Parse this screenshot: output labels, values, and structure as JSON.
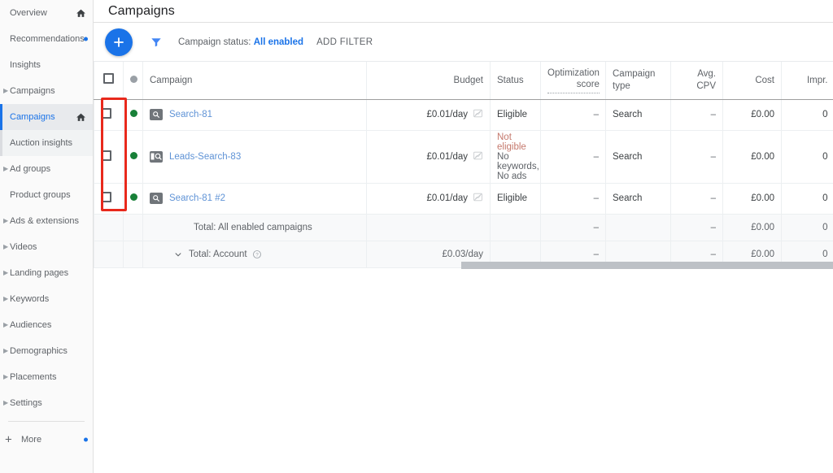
{
  "sidebar": {
    "items": [
      {
        "label": "Overview",
        "icon": "home-icon",
        "arrow": false,
        "dot": false,
        "state": "normal"
      },
      {
        "label": "Recommendations",
        "icon": "",
        "arrow": false,
        "dot": true,
        "state": "normal"
      },
      {
        "label": "Insights",
        "icon": "",
        "arrow": false,
        "dot": false,
        "state": "normal"
      },
      {
        "label": "Campaigns",
        "icon": "",
        "arrow": true,
        "dot": false,
        "state": "group"
      },
      {
        "label": "Campaigns",
        "icon": "home-icon",
        "arrow": false,
        "dot": false,
        "state": "selected"
      },
      {
        "label": "Auction insights",
        "icon": "",
        "arrow": false,
        "dot": false,
        "state": "sub"
      },
      {
        "label": "Ad groups",
        "icon": "",
        "arrow": true,
        "dot": false,
        "state": "normal"
      },
      {
        "label": "Product groups",
        "icon": "",
        "arrow": false,
        "dot": false,
        "state": "normal"
      },
      {
        "label": "Ads & extensions",
        "icon": "",
        "arrow": true,
        "dot": false,
        "state": "normal"
      },
      {
        "label": "Videos",
        "icon": "",
        "arrow": true,
        "dot": false,
        "state": "normal"
      },
      {
        "label": "Landing pages",
        "icon": "",
        "arrow": true,
        "dot": false,
        "state": "normal"
      },
      {
        "label": "Keywords",
        "icon": "",
        "arrow": true,
        "dot": false,
        "state": "normal"
      },
      {
        "label": "Audiences",
        "icon": "",
        "arrow": true,
        "dot": false,
        "state": "normal"
      },
      {
        "label": "Demographics",
        "icon": "",
        "arrow": true,
        "dot": false,
        "state": "normal"
      },
      {
        "label": "Placements",
        "icon": "",
        "arrow": true,
        "dot": false,
        "state": "normal"
      },
      {
        "label": "Settings",
        "icon": "",
        "arrow": true,
        "dot": false,
        "state": "normal"
      }
    ],
    "more_label": "More"
  },
  "header": {
    "title": "Campaigns"
  },
  "toolbar": {
    "add_label": "+",
    "filter_status_prefix": "Campaign status:",
    "filter_status_value": "All enabled",
    "add_filter_label": "ADD FILTER"
  },
  "table": {
    "columns": [
      "Campaign",
      "Budget",
      "Status",
      "Optimization score",
      "Campaign type",
      "Avg. CPV",
      "Cost",
      "Impr."
    ],
    "col_opt_line1": "Optimization",
    "col_opt_line2": "score",
    "col_type_line1": "Campaign",
    "col_type_line2": "type",
    "rows": [
      {
        "name": "Search-81",
        "icon": "search-campaign-icon",
        "budget": "£0.01/day",
        "status": "Eligible",
        "status_detail": "",
        "opt_score": "–",
        "type": "Search",
        "avg_cpv": "–",
        "cost": "£0.00",
        "impr": "0"
      },
      {
        "name": "Leads-Search-83",
        "icon": "leads-campaign-icon",
        "budget": "£0.01/day",
        "status": "Not eligible",
        "status_detail": "No keywords, No ads",
        "opt_score": "–",
        "type": "Search",
        "avg_cpv": "–",
        "cost": "£0.00",
        "impr": "0"
      },
      {
        "name": "Search-81 #2",
        "icon": "search-campaign-icon",
        "budget": "£0.01/day",
        "status": "Eligible",
        "status_detail": "",
        "opt_score": "–",
        "type": "Search",
        "avg_cpv": "–",
        "cost": "£0.00",
        "impr": "0"
      }
    ],
    "totals": [
      {
        "label": "Total: All enabled campaigns",
        "budget": "",
        "status": "",
        "opt_score": "–",
        "type": "",
        "avg_cpv": "–",
        "cost": "£0.00",
        "impr": "0"
      },
      {
        "label": "Total: Account",
        "budget": "£0.03/day",
        "status": "",
        "opt_score": "–",
        "type": "",
        "avg_cpv": "–",
        "cost": "£0.00",
        "impr": "0"
      }
    ]
  },
  "annotation": {
    "highlight_color": "#e8291c"
  },
  "colors": {
    "accent_blue": "#1a73e8",
    "link_blue": "#5f93d6",
    "status_green": "#188038",
    "status_red": "#c5796d",
    "text_primary": "#202124",
    "text_secondary": "#5f6368"
  }
}
